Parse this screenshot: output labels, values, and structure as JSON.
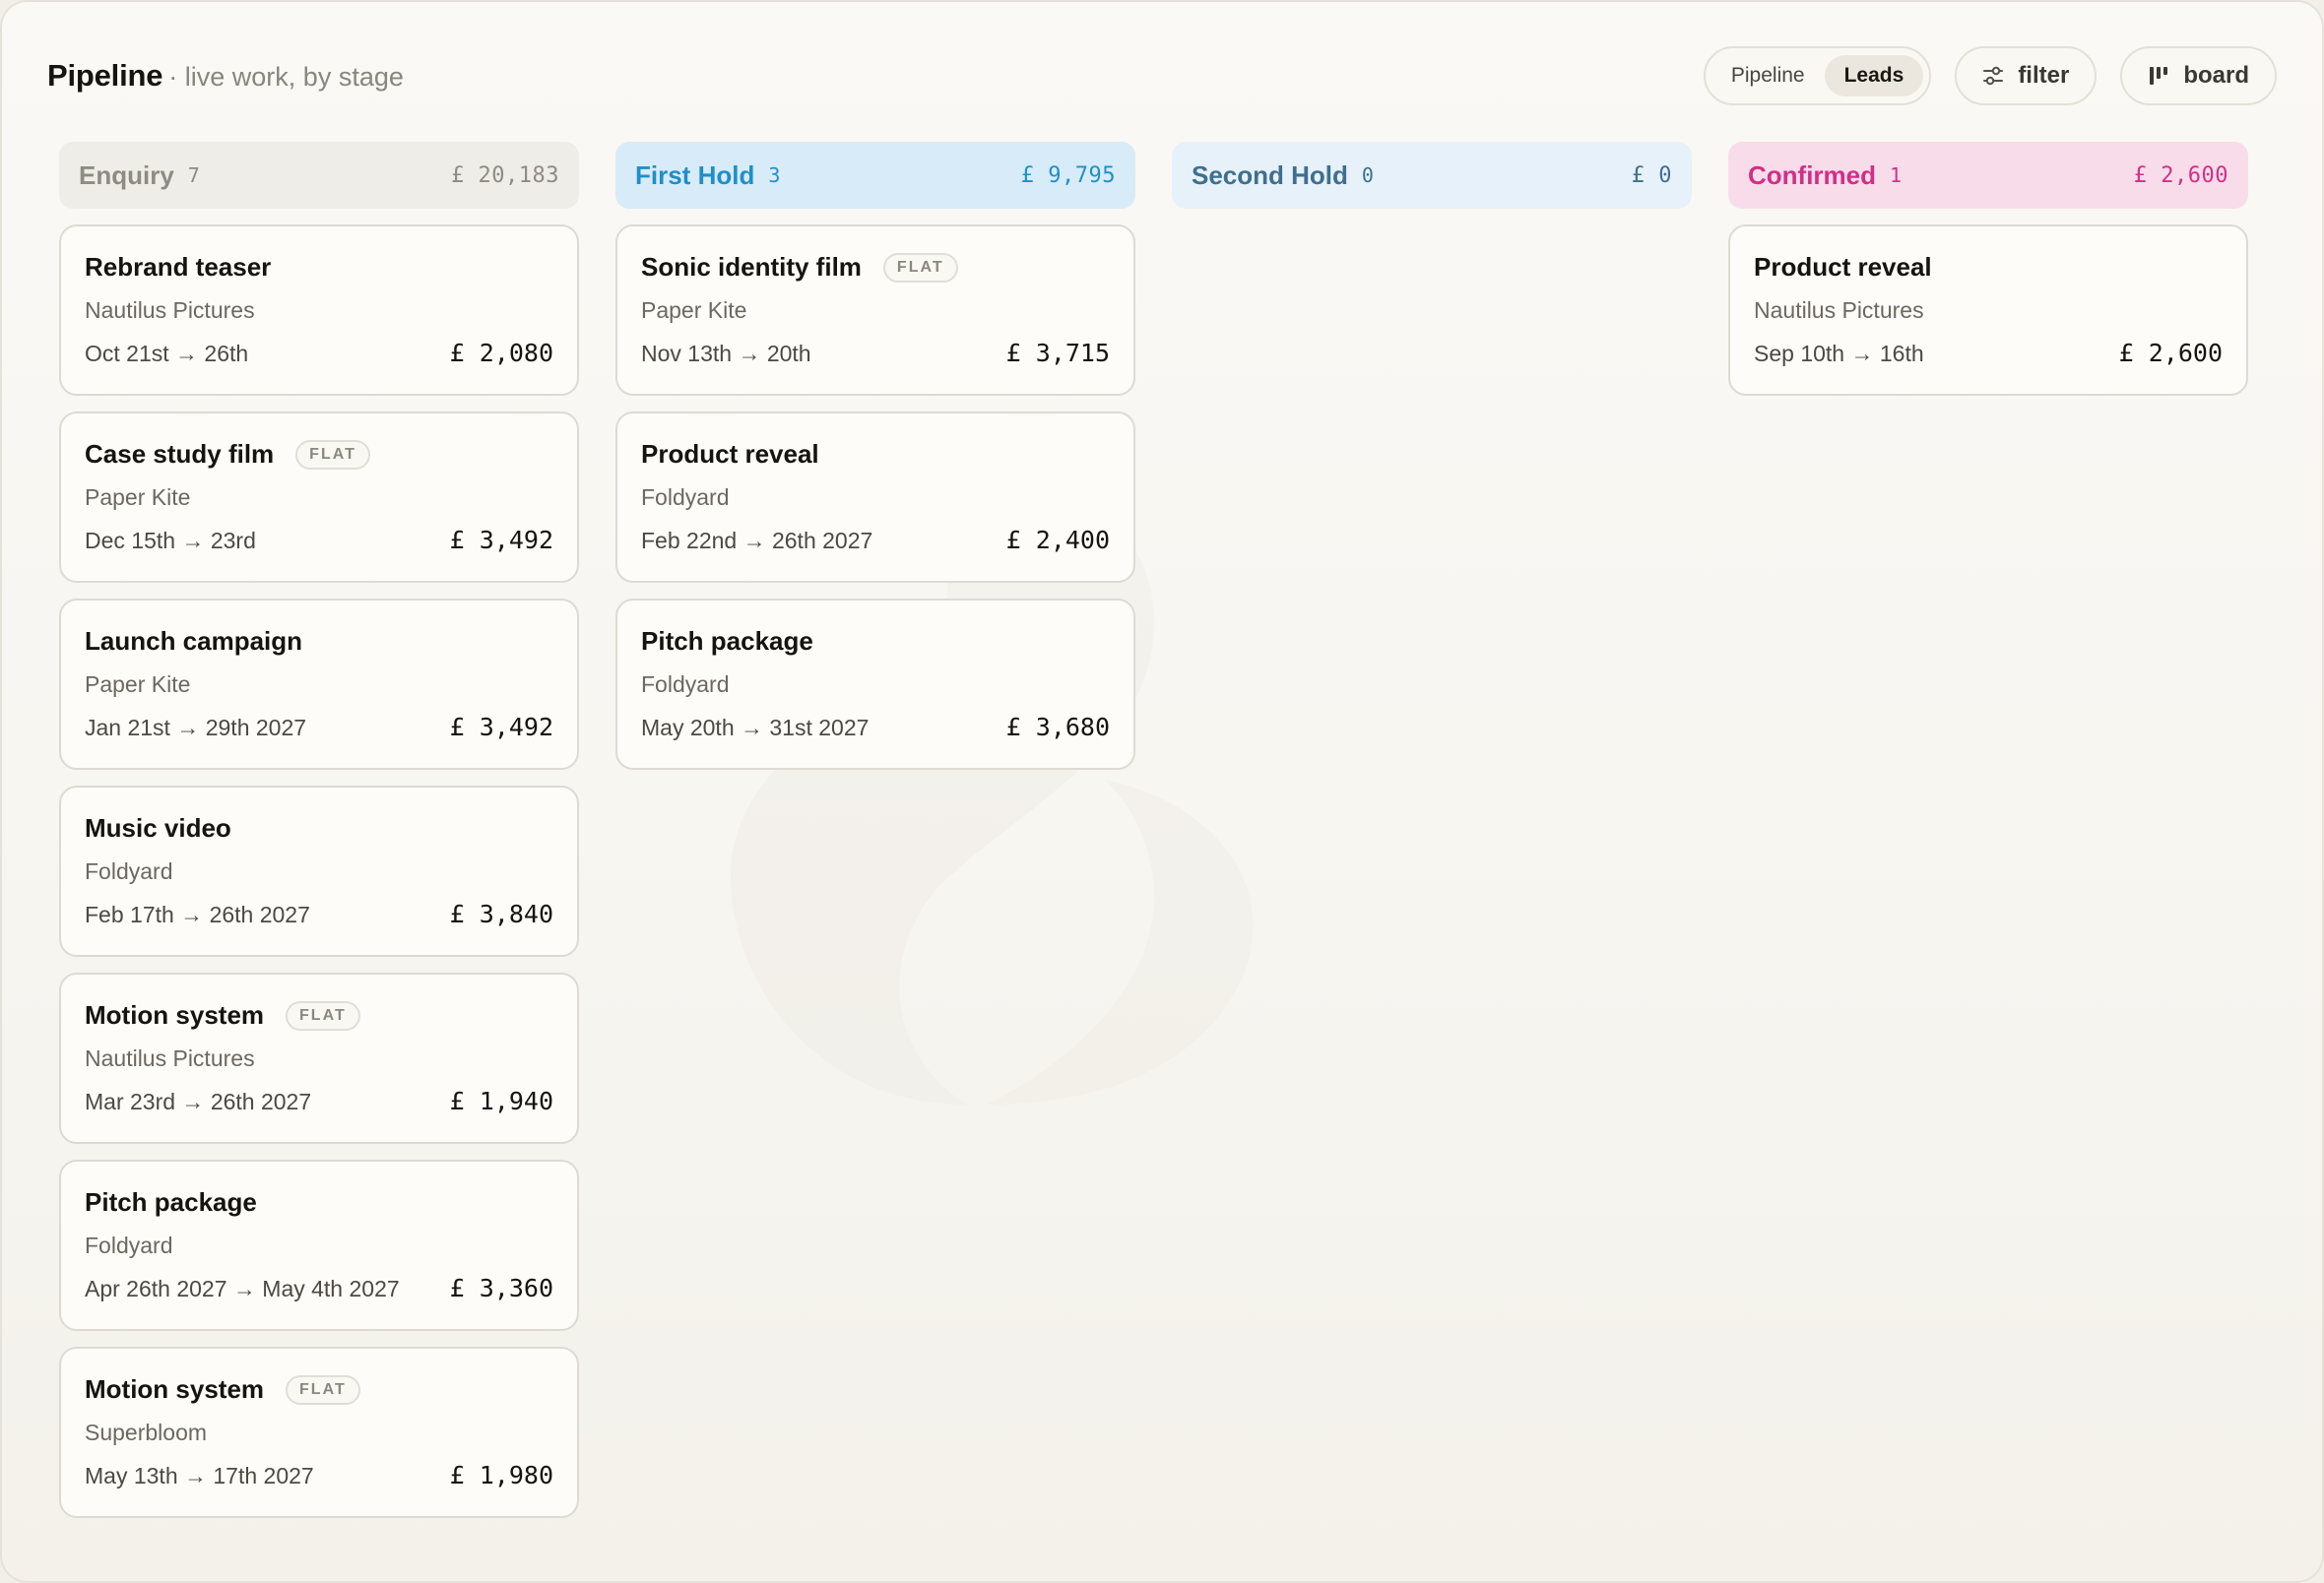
{
  "header": {
    "title": "Pipeline",
    "subtitle": "· live work, by stage",
    "view_toggle": [
      {
        "label": "Pipeline",
        "active": false
      },
      {
        "label": "Leads",
        "active": true
      }
    ],
    "filter_label": "filter",
    "board_label": "board"
  },
  "colors": {
    "enquiry_bg": "#efede8",
    "enquiry_text": "#8f8b83",
    "first_hold_bg": "#d8ebf8",
    "first_hold_text": "#1f8fc9",
    "second_hold_bg": "#e7f1fa",
    "second_hold_text": "#3f6f8e",
    "confirmed_bg": "#f8dcea",
    "confirmed_text": "#d12f86"
  },
  "columns": [
    {
      "name": "Enquiry",
      "count": "7",
      "total": "£ 20,183",
      "cards": [
        {
          "title": "Rebrand teaser",
          "client": "Nautilus Pictures",
          "dates": "Oct 21st → 26th",
          "amount": "£ 2,080",
          "badge": ""
        },
        {
          "title": "Case study film",
          "client": "Paper Kite",
          "dates": "Dec 15th → 23rd",
          "amount": "£ 3,492",
          "badge": "FLAT"
        },
        {
          "title": "Launch campaign",
          "client": "Paper Kite",
          "dates": "Jan 21st → 29th 2027",
          "amount": "£ 3,492",
          "badge": ""
        },
        {
          "title": "Music video",
          "client": "Foldyard",
          "dates": "Feb 17th → 26th 2027",
          "amount": "£ 3,840",
          "badge": ""
        },
        {
          "title": "Motion system",
          "client": "Nautilus Pictures",
          "dates": "Mar 23rd → 26th 2027",
          "amount": "£ 1,940",
          "badge": "FLAT"
        },
        {
          "title": "Pitch package",
          "client": "Foldyard",
          "dates": "Apr 26th 2027 → May 4th 2027",
          "amount": "£ 3,360",
          "badge": ""
        },
        {
          "title": "Motion system",
          "client": "Superbloom",
          "dates": "May 13th → 17th 2027",
          "amount": "£ 1,980",
          "badge": "FLAT"
        }
      ]
    },
    {
      "name": "First Hold",
      "count": "3",
      "total": "£ 9,795",
      "cards": [
        {
          "title": "Sonic identity film",
          "client": "Paper Kite",
          "dates": "Nov 13th → 20th",
          "amount": "£ 3,715",
          "badge": "FLAT"
        },
        {
          "title": "Product reveal",
          "client": "Foldyard",
          "dates": "Feb 22nd → 26th 2027",
          "amount": "£ 2,400",
          "badge": ""
        },
        {
          "title": "Pitch package",
          "client": "Foldyard",
          "dates": "May 20th → 31st 2027",
          "amount": "£ 3,680",
          "badge": ""
        }
      ]
    },
    {
      "name": "Second Hold",
      "count": "0",
      "total": "£ 0",
      "cards": []
    },
    {
      "name": "Confirmed",
      "count": "1",
      "total": "£ 2,600",
      "cards": [
        {
          "title": "Product reveal",
          "client": "Nautilus Pictures",
          "dates": "Sep 10th → 16th",
          "amount": "£ 2,600",
          "badge": ""
        }
      ]
    }
  ]
}
